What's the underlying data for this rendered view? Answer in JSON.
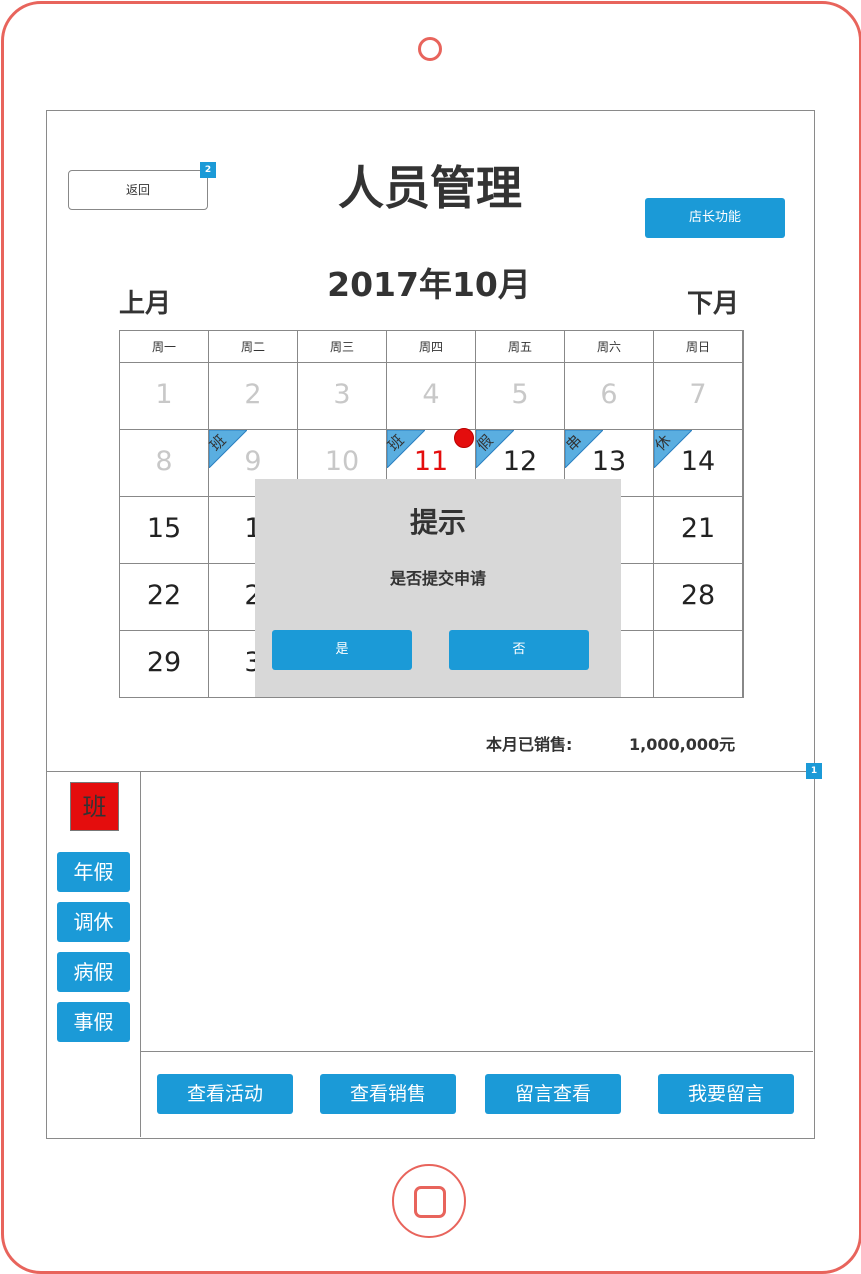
{
  "header": {
    "title": "人员管理",
    "back_label": "返回",
    "manager_label": "店长功能",
    "badge_top": "2",
    "badge_mid": "1"
  },
  "calendar": {
    "month_title": "2017年10月",
    "prev_label": "上月",
    "next_label": "下月",
    "weekdays": [
      "周一",
      "周二",
      "周三",
      "周四",
      "周五",
      "周六",
      "周日"
    ],
    "rows": [
      [
        "1",
        "2",
        "3",
        "4",
        "5",
        "6",
        "7"
      ],
      [
        "8",
        "9",
        "10",
        "11",
        "12",
        "13",
        "14"
      ],
      [
        "15",
        "1",
        "",
        "",
        "",
        "0",
        "21"
      ],
      [
        "22",
        "2",
        "",
        "",
        "",
        "7",
        "28"
      ],
      [
        "29",
        "3",
        "",
        "",
        "",
        "",
        ""
      ]
    ],
    "flags": {
      "9": "班",
      "11": "班",
      "12": "假",
      "13": "串",
      "14": "休"
    }
  },
  "dialog": {
    "title": "提示",
    "message": "是否提交申请",
    "yes_label": "是",
    "no_label": "否"
  },
  "sales": {
    "label": "本月已销售:",
    "value": "1,000,000元"
  },
  "legend": {
    "shift_label": "班",
    "items": [
      "年假",
      "调休",
      "病假",
      "事假"
    ]
  },
  "actions": [
    "查看活动",
    "查看销售",
    "留言查看",
    "我要留言"
  ],
  "colors": {
    "accent": "#1b9ad7",
    "frame": "#e8645c",
    "today": "#e40d0d"
  }
}
